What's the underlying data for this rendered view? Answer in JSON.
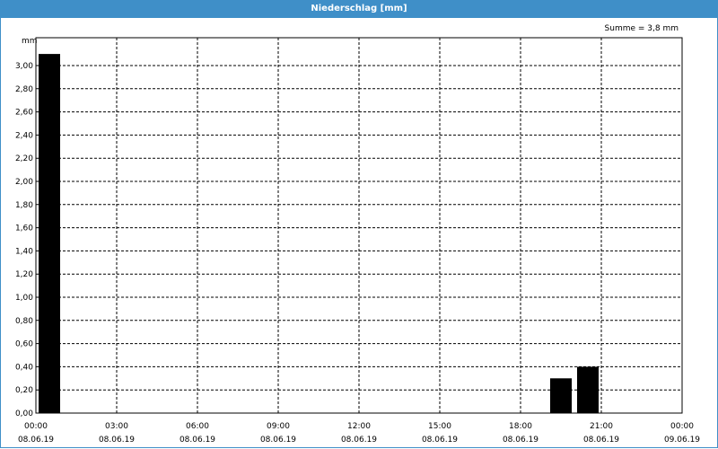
{
  "window": {
    "title": "Niederschlag [mm]"
  },
  "chart_data": {
    "type": "bar",
    "title": "Niederschlag [mm]",
    "annotation": "Summe = 3,8 mm",
    "ylabel": "mm",
    "ylim": [
      0,
      3.1
    ],
    "yticks": [
      "0,00",
      "0,20",
      "0,40",
      "0,60",
      "0,80",
      "1,00",
      "1,20",
      "1,40",
      "1,60",
      "1,80",
      "2,00",
      "2,20",
      "2,40",
      "2,60",
      "2,80",
      "3,00"
    ],
    "xlim_hours": [
      0,
      24
    ],
    "xticks": [
      {
        "time": "00:00",
        "date": "08.06.19"
      },
      {
        "time": "03:00",
        "date": "08.06.19"
      },
      {
        "time": "06:00",
        "date": "08.06.19"
      },
      {
        "time": "09:00",
        "date": "08.06.19"
      },
      {
        "time": "12:00",
        "date": "08.06.19"
      },
      {
        "time": "15:00",
        "date": "08.06.19"
      },
      {
        "time": "18:00",
        "date": "08.06.19"
      },
      {
        "time": "21:00",
        "date": "08.06.19"
      },
      {
        "time": "00:00",
        "date": "09.06.19"
      }
    ],
    "grid": true,
    "bar_color": "#000000",
    "series": [
      {
        "values": [
          {
            "start": "08.06.19 00:00",
            "end": "08.06.19 01:00",
            "value": 3.1
          },
          {
            "start": "08.06.19 19:00",
            "end": "08.06.19 20:00",
            "value": 0.3
          },
          {
            "start": "08.06.19 20:00",
            "end": "08.06.19 21:00",
            "value": 0.4
          }
        ]
      }
    ]
  }
}
